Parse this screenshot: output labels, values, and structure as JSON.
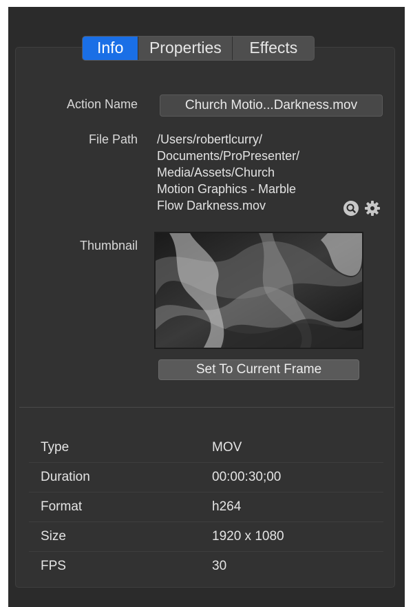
{
  "tabs": [
    {
      "label": "Info",
      "active": true
    },
    {
      "label": "Properties",
      "active": false
    },
    {
      "label": "Effects",
      "active": false
    }
  ],
  "form": {
    "action_name_label": "Action Name",
    "action_name_value": "Church Motio...Darkness.mov",
    "file_path_label": "File Path",
    "file_path_lines": [
      "/Users/robertlcurry/",
      "Documents/ProPresenter/",
      "Media/Assets/Church",
      "Motion Graphics - Marble",
      "Flow Darkness.mov"
    ],
    "thumbnail_label": "Thumbnail",
    "set_frame_button": "Set To Current Frame"
  },
  "icons": {
    "reveal": "magnifier-icon",
    "settings": "gear-icon"
  },
  "properties": [
    {
      "key": "Type",
      "value": "MOV"
    },
    {
      "key": "Duration",
      "value": "00:00:30;00"
    },
    {
      "key": "Format",
      "value": "h264"
    },
    {
      "key": "Size",
      "value": "1920 x 1080"
    },
    {
      "key": "FPS",
      "value": "30"
    }
  ],
  "colors": {
    "accent": "#1a6fe6",
    "background": "#2b2b2b",
    "panel": "#323232"
  }
}
